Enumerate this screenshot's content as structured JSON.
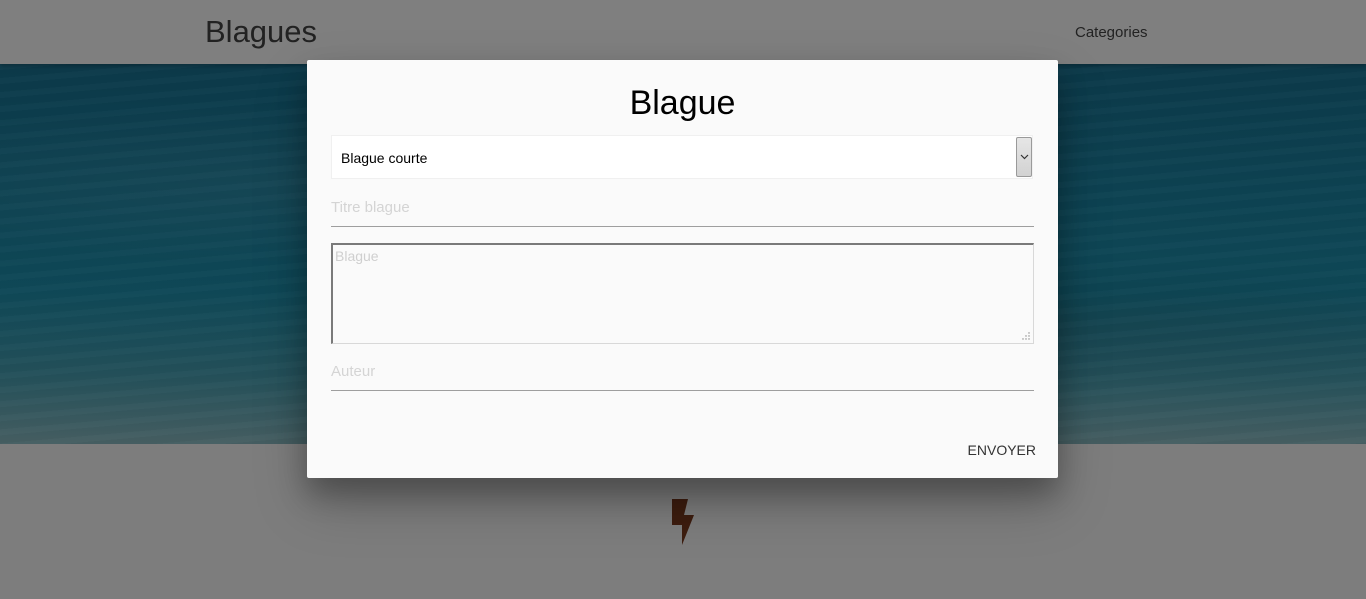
{
  "navbar": {
    "brand": "Blagues",
    "links": [
      "Categories"
    ]
  },
  "icons": {
    "bolt": "bolt-icon"
  },
  "modal": {
    "title": "Blague",
    "type_select": {
      "value": "Blague courte"
    },
    "title_field": {
      "placeholder": "Titre blague",
      "value": ""
    },
    "joke_textarea": {
      "placeholder": "Blague",
      "value": ""
    },
    "author_field": {
      "placeholder": "Auteur",
      "value": ""
    },
    "submit_label": "ENVOYER"
  },
  "colors": {
    "overlay": "rgba(0,0,0,0.5)",
    "modal_bg": "#fafafa",
    "bolt": "#7b3a1e"
  }
}
